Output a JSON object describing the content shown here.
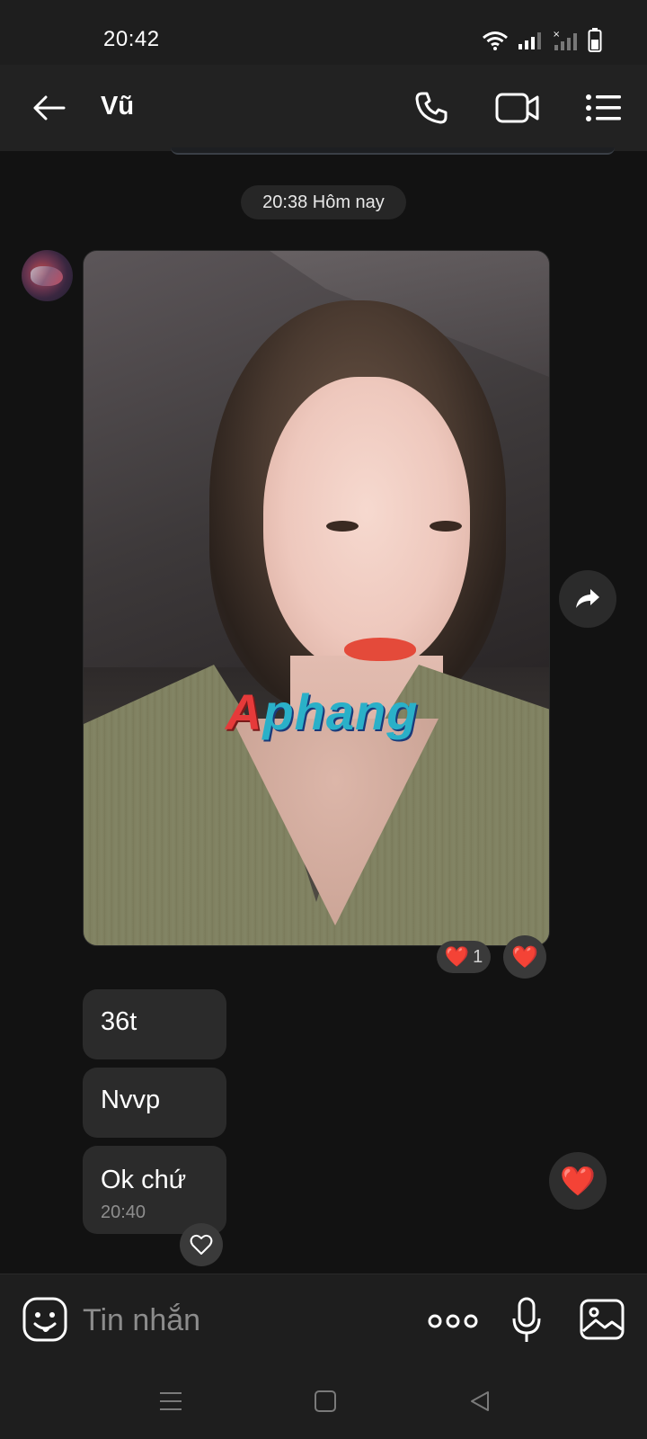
{
  "status_bar": {
    "time": "20:42"
  },
  "header": {
    "contact_name": "Vũ"
  },
  "chat": {
    "date_separator": "20:38 Hôm nay",
    "photo_watermark": {
      "first_letter": "A",
      "rest": "phang"
    },
    "photo_reaction": {
      "emoji": "❤️",
      "count": "1"
    },
    "reaction_button_emoji": "❤️",
    "messages": [
      {
        "text": "36t"
      },
      {
        "text": "Nvvp"
      },
      {
        "text": "Ok chứ",
        "time": "20:40"
      }
    ],
    "quick_reaction_emoji": "❤️"
  },
  "input_bar": {
    "placeholder": "Tin nhắn"
  },
  "icons": {
    "back": "arrow-left-icon",
    "call": "phone-icon",
    "video": "video-camera-icon",
    "menu": "list-menu-icon",
    "share": "share-arrow-icon",
    "emoji": "sticker-face-icon",
    "more": "more-dots-icon",
    "mic": "microphone-icon",
    "gallery": "image-icon"
  },
  "colors": {
    "background": "#121212",
    "bubble": "#2b2b2b",
    "heart": "#e8322f"
  }
}
